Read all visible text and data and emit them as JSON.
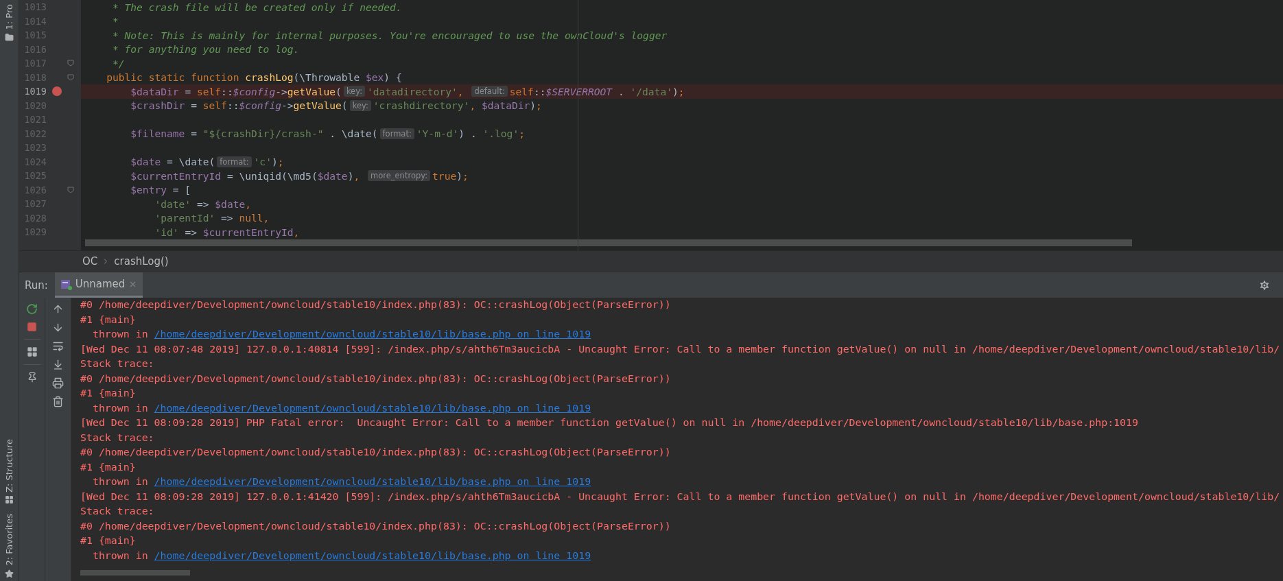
{
  "tool_windows": {
    "top": [
      {
        "label": "1: Pro"
      }
    ],
    "bottom": [
      {
        "label": "Z: Structure"
      },
      {
        "label": "2: Favorites"
      }
    ]
  },
  "editor": {
    "lines": [
      {
        "number": "1013",
        "breakpoint": false,
        "fold": false,
        "segments": [
          {
            "kind": "code",
            "tokens": [
              {
                "kind": "comment",
                "text": "     * The crash file will be created only if needed."
              }
            ]
          }
        ]
      },
      {
        "number": "1014",
        "breakpoint": false,
        "fold": false,
        "segments": [
          {
            "kind": "code",
            "tokens": [
              {
                "kind": "comment",
                "text": "     *"
              }
            ]
          }
        ]
      },
      {
        "number": "1015",
        "breakpoint": false,
        "fold": false,
        "segments": [
          {
            "kind": "code",
            "tokens": [
              {
                "kind": "comment",
                "text": "     * Note: This is mainly for internal purposes. You're encouraged to use the ownCloud's logger"
              }
            ]
          }
        ]
      },
      {
        "number": "1016",
        "breakpoint": false,
        "fold": false,
        "segments": [
          {
            "kind": "code",
            "tokens": [
              {
                "kind": "comment",
                "text": "     * for anything you need to log."
              }
            ]
          }
        ]
      },
      {
        "number": "1017",
        "breakpoint": false,
        "fold": true,
        "segments": [
          {
            "kind": "code",
            "tokens": [
              {
                "kind": "comment",
                "text": "     */"
              }
            ]
          }
        ]
      },
      {
        "number": "1018",
        "breakpoint": false,
        "fold": true,
        "segments": [
          {
            "kind": "code",
            "tokens": [
              {
                "kind": "kw",
                "text": "    public static function "
              },
              {
                "kind": "fn",
                "text": "crashLog"
              },
              {
                "kind": "plain",
                "text": "(\\Throwable "
              },
              {
                "kind": "var",
                "text": "$ex"
              },
              {
                "kind": "plain",
                "text": ") {"
              }
            ]
          }
        ]
      },
      {
        "number": "1019",
        "breakpoint": true,
        "fold": false,
        "segments": [
          {
            "kind": "code",
            "tokens": [
              {
                "kind": "var",
                "text": "        $dataDir"
              },
              {
                "kind": "plain",
                "text": " = "
              },
              {
                "kind": "kw",
                "text": "self"
              },
              {
                "kind": "plain",
                "text": "::"
              },
              {
                "kind": "field",
                "text": "$config"
              },
              {
                "kind": "plain",
                "text": "->"
              },
              {
                "kind": "fn",
                "text": "getValue"
              },
              {
                "kind": "plain",
                "text": "("
              }
            ]
          },
          {
            "kind": "hint",
            "text": "key:"
          },
          {
            "kind": "code",
            "tokens": [
              {
                "kind": "str",
                "text": "'datadirectory'"
              },
              {
                "kind": "kw",
                "text": ", "
              }
            ]
          },
          {
            "kind": "hint",
            "text": "default:"
          },
          {
            "kind": "code",
            "tokens": [
              {
                "kind": "kw",
                "text": "self"
              },
              {
                "kind": "plain",
                "text": "::"
              },
              {
                "kind": "field",
                "text": "$SERVERROOT"
              },
              {
                "kind": "plain",
                "text": " . "
              },
              {
                "kind": "str",
                "text": "'/data'"
              },
              {
                "kind": "plain",
                "text": ")"
              },
              {
                "kind": "kw",
                "text": ";"
              }
            ]
          }
        ]
      },
      {
        "number": "1020",
        "breakpoint": false,
        "fold": false,
        "segments": [
          {
            "kind": "code",
            "tokens": [
              {
                "kind": "var",
                "text": "        $crashDir"
              },
              {
                "kind": "plain",
                "text": " = "
              },
              {
                "kind": "kw",
                "text": "self"
              },
              {
                "kind": "plain",
                "text": "::"
              },
              {
                "kind": "field",
                "text": "$config"
              },
              {
                "kind": "plain",
                "text": "->"
              },
              {
                "kind": "fn",
                "text": "getValue"
              },
              {
                "kind": "plain",
                "text": "("
              }
            ]
          },
          {
            "kind": "hint",
            "text": "key:"
          },
          {
            "kind": "code",
            "tokens": [
              {
                "kind": "str",
                "text": "'crashdirectory'"
              },
              {
                "kind": "kw",
                "text": ", "
              },
              {
                "kind": "var",
                "text": "$dataDir"
              },
              {
                "kind": "plain",
                "text": ")"
              },
              {
                "kind": "kw",
                "text": ";"
              }
            ]
          }
        ]
      },
      {
        "number": "1021",
        "breakpoint": false,
        "fold": false
      },
      {
        "number": "1022",
        "breakpoint": false,
        "fold": false,
        "segments": [
          {
            "kind": "code",
            "tokens": [
              {
                "kind": "var",
                "text": "        $filename"
              },
              {
                "kind": "plain",
                "text": " = "
              },
              {
                "kind": "str",
                "text": "\"${crashDir}/crash-\""
              },
              {
                "kind": "plain",
                "text": " . \\date("
              }
            ]
          },
          {
            "kind": "hint",
            "text": "format:"
          },
          {
            "kind": "code",
            "tokens": [
              {
                "kind": "str",
                "text": "'Y-m-d'"
              },
              {
                "kind": "plain",
                "text": ") . "
              },
              {
                "kind": "str",
                "text": "'.log'"
              },
              {
                "kind": "kw",
                "text": ";"
              }
            ]
          }
        ]
      },
      {
        "number": "1023",
        "breakpoint": false,
        "fold": false
      },
      {
        "number": "1024",
        "breakpoint": false,
        "fold": false,
        "segments": [
          {
            "kind": "code",
            "tokens": [
              {
                "kind": "var",
                "text": "        $date"
              },
              {
                "kind": "plain",
                "text": " = \\date("
              }
            ]
          },
          {
            "kind": "hint",
            "text": "format:"
          },
          {
            "kind": "code",
            "tokens": [
              {
                "kind": "str",
                "text": "'c'"
              },
              {
                "kind": "plain",
                "text": ")"
              },
              {
                "kind": "kw",
                "text": ";"
              }
            ]
          }
        ]
      },
      {
        "number": "1025",
        "breakpoint": false,
        "fold": false,
        "segments": [
          {
            "kind": "code",
            "tokens": [
              {
                "kind": "var",
                "text": "        $currentEntryId"
              },
              {
                "kind": "plain",
                "text": " = \\uniqid(\\md5("
              },
              {
                "kind": "var",
                "text": "$date"
              },
              {
                "kind": "plain",
                "text": ")"
              },
              {
                "kind": "kw",
                "text": ", "
              }
            ]
          },
          {
            "kind": "hint",
            "text": "more_entropy:"
          },
          {
            "kind": "code",
            "tokens": [
              {
                "kind": "kw",
                "text": "true"
              },
              {
                "kind": "plain",
                "text": ")"
              },
              {
                "kind": "kw",
                "text": ";"
              }
            ]
          }
        ]
      },
      {
        "number": "1026",
        "breakpoint": false,
        "fold": true,
        "segments": [
          {
            "kind": "code",
            "tokens": [
              {
                "kind": "var",
                "text": "        $entry"
              },
              {
                "kind": "plain",
                "text": " = ["
              }
            ]
          }
        ]
      },
      {
        "number": "1027",
        "breakpoint": false,
        "fold": false,
        "segments": [
          {
            "kind": "code",
            "tokens": [
              {
                "kind": "str",
                "text": "            'date'"
              },
              {
                "kind": "plain",
                "text": " => "
              },
              {
                "kind": "var",
                "text": "$date"
              },
              {
                "kind": "kw",
                "text": ","
              }
            ]
          }
        ]
      },
      {
        "number": "1028",
        "breakpoint": false,
        "fold": false,
        "segments": [
          {
            "kind": "code",
            "tokens": [
              {
                "kind": "str",
                "text": "            'parentId'"
              },
              {
                "kind": "plain",
                "text": " => "
              },
              {
                "kind": "kw",
                "text": "null"
              },
              {
                "kind": "kw",
                "text": ","
              }
            ]
          }
        ]
      },
      {
        "number": "1029",
        "breakpoint": false,
        "fold": false,
        "segments": [
          {
            "kind": "code",
            "tokens": [
              {
                "kind": "str",
                "text": "            'id'"
              },
              {
                "kind": "plain",
                "text": " => "
              },
              {
                "kind": "var",
                "text": "$currentEntryId"
              },
              {
                "kind": "kw",
                "text": ","
              }
            ]
          }
        ]
      }
    ],
    "breadcrumb": [
      "OC",
      "crashLog()"
    ]
  },
  "run": {
    "label": "Run:",
    "tabs": [
      {
        "label": "Unnamed",
        "selected": true
      }
    ],
    "output": [
      {
        "kind": "error",
        "text": "#0 /home/deepdiver/Development/owncloud/stable10/index.php(83): OC::crashLog(Object(ParseError))"
      },
      {
        "kind": "error",
        "text": "#1 {main}"
      },
      {
        "kind": "thrown",
        "text": "  thrown in ",
        "link": "/home/deepdiver/Development/owncloud/stable10/lib/base.php on line 1019"
      },
      {
        "kind": "error",
        "text": "[Wed Dec 11 08:07:48 2019] 127.0.0.1:40814 [599]: /index.php/s/ahth6Tm3aucicbA - Uncaught Error: Call to a member function getValue() on null in /home/deepdiver/Development/owncloud/stable10/lib/"
      },
      {
        "kind": "error",
        "text": "Stack trace:"
      },
      {
        "kind": "error",
        "text": "#0 /home/deepdiver/Development/owncloud/stable10/index.php(83): OC::crashLog(Object(ParseError))"
      },
      {
        "kind": "error",
        "text": "#1 {main}"
      },
      {
        "kind": "thrown",
        "text": "  thrown in ",
        "link": "/home/deepdiver/Development/owncloud/stable10/lib/base.php on line 1019"
      },
      {
        "kind": "error",
        "text": "[Wed Dec 11 08:09:28 2019] PHP Fatal error:  Uncaught Error: Call to a member function getValue() on null in /home/deepdiver/Development/owncloud/stable10/lib/base.php:1019"
      },
      {
        "kind": "error",
        "text": "Stack trace:"
      },
      {
        "kind": "error",
        "text": "#0 /home/deepdiver/Development/owncloud/stable10/index.php(83): OC::crashLog(Object(ParseError))"
      },
      {
        "kind": "error",
        "text": "#1 {main}"
      },
      {
        "kind": "thrown",
        "text": "  thrown in ",
        "link": "/home/deepdiver/Development/owncloud/stable10/lib/base.php on line 1019"
      },
      {
        "kind": "error",
        "text": "[Wed Dec 11 08:09:28 2019] 127.0.0.1:41420 [599]: /index.php/s/ahth6Tm3aucicbA - Uncaught Error: Call to a member function getValue() on null in /home/deepdiver/Development/owncloud/stable10/lib/"
      },
      {
        "kind": "error",
        "text": "Stack trace:"
      },
      {
        "kind": "error",
        "text": "#0 /home/deepdiver/Development/owncloud/stable10/index.php(83): OC::crashLog(Object(ParseError))"
      },
      {
        "kind": "error",
        "text": "#1 {main}"
      },
      {
        "kind": "thrown",
        "text": "  thrown in ",
        "link": "/home/deepdiver/Development/owncloud/stable10/lib/base.php on line 1019"
      }
    ]
  }
}
